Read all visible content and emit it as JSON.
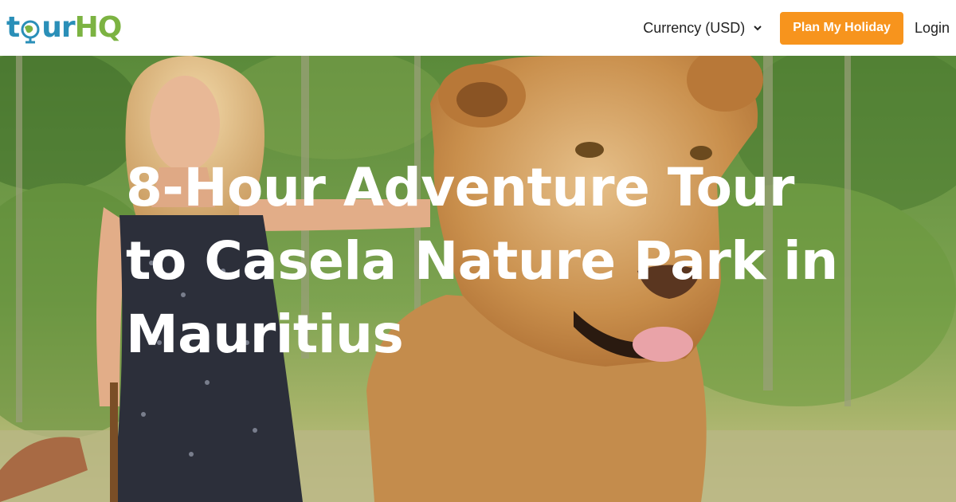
{
  "header": {
    "logo": {
      "part1": "t",
      "part2": "ur",
      "part3": "HQ"
    },
    "currency_label": "Currency (USD)",
    "plan_button": "Plan My Holiday",
    "login": "Login"
  },
  "hero": {
    "title": "8-Hour Adventure Tour to Casela Nature Park in Mauritius"
  },
  "colors": {
    "brand_blue": "#2a8fb8",
    "brand_green": "#7cb342",
    "accent_orange": "#f7941d"
  }
}
